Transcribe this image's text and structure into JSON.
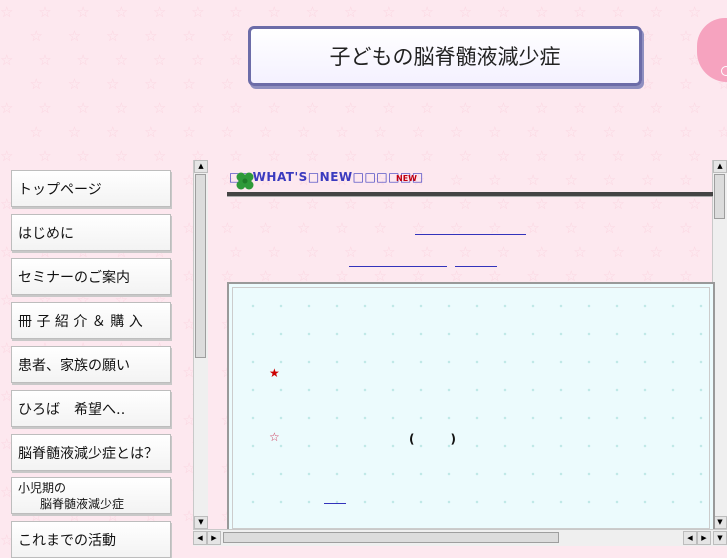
{
  "header": {
    "title": "子どもの脳脊髄液減少症"
  },
  "nav": {
    "items": [
      {
        "label": "トップページ"
      },
      {
        "label": "はじめに"
      },
      {
        "label": "セミナーのご案内"
      },
      {
        "label": "冊 子 紹 介 ＆ 購 入"
      },
      {
        "label": "患者、家族の願い"
      },
      {
        "label": "ひろば　希望へ‥"
      },
      {
        "label": "脳脊髄液減少症とは？"
      },
      {
        "label_line1": "小児期の",
        "label_line2": "脳脊髄液減少症"
      },
      {
        "label": "これまでの活動"
      }
    ]
  },
  "news": {
    "heading": "□□WHAT'S□NEW□□□□□□",
    "badge": "NEW",
    "star_filled": "★",
    "star_outline": "☆",
    "paren": "(　　　)"
  },
  "colors": {
    "background": "#fde8ef",
    "heading_text": "#3b3bbf",
    "badge": "#c00010",
    "title_border": "#6c6ca8"
  }
}
